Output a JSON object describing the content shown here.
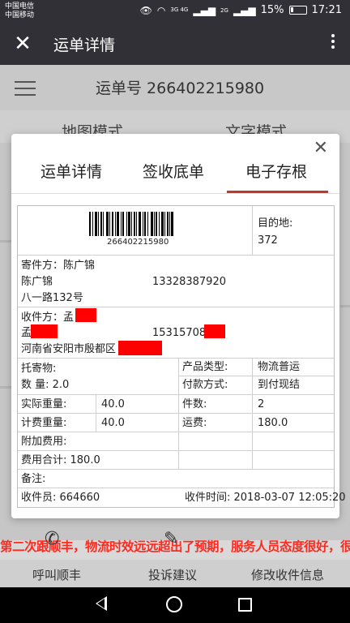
{
  "status_bar": {
    "carrier1": "中国电信",
    "carrier2": "中国移动",
    "net1": "3G 4G",
    "net2": "2G",
    "battery": "15%",
    "time": "17:21"
  },
  "title_bar": {
    "title": "运单详情"
  },
  "background": {
    "waybill_label": "运单号 266402215980",
    "tab_map": "地图模式",
    "tab_text": "文字模式",
    "promo_text": "第二次跟顺丰，物流时效远远超出了预期，服务人员态度很好，很有礼貌，真心好评，点个赞",
    "call_label": "呼叫顺丰",
    "complaint_label": "投诉建议",
    "modify_label": "修改收件信息"
  },
  "modal": {
    "tabs": [
      {
        "label": "运单详情"
      },
      {
        "label": "签收底单"
      },
      {
        "label": "电子存根",
        "active": true
      }
    ],
    "accent_color": "#c0392b",
    "barcode_number": "266402215980",
    "destination_label": "目的地:",
    "destination_code": "372",
    "sender_label": "寄件方：陈广锦",
    "sender_name": "陈广锦",
    "sender_phone": "13328387920",
    "sender_address": "八一路132号",
    "receiver_label": "收件方：孟",
    "receiver_name": "孟",
    "receiver_phone": "153157081",
    "receiver_address": "河南省安阳市殷都区",
    "goods_label": "托寄物:",
    "quantity": "数  量:  2.0",
    "product_type_label": "产品类型:",
    "product_type": "物流普运",
    "payment_label": "付款方式:",
    "payment": "到付现结",
    "actual_weight_label": "实际重量:",
    "actual_weight": "40.0",
    "pieces_label": "件数:",
    "pieces": "2",
    "billing_weight_label": "计费重量:",
    "billing_weight": "40.0",
    "freight_label": "运费:",
    "freight": "180.0",
    "extra_fee": "附加费用:",
    "total_fee": "费用合计:  180.0",
    "remarks": "备注:",
    "courier": "收件员:  664660",
    "pickup_time": "收件时间:  2018-03-07 12:05:20"
  }
}
